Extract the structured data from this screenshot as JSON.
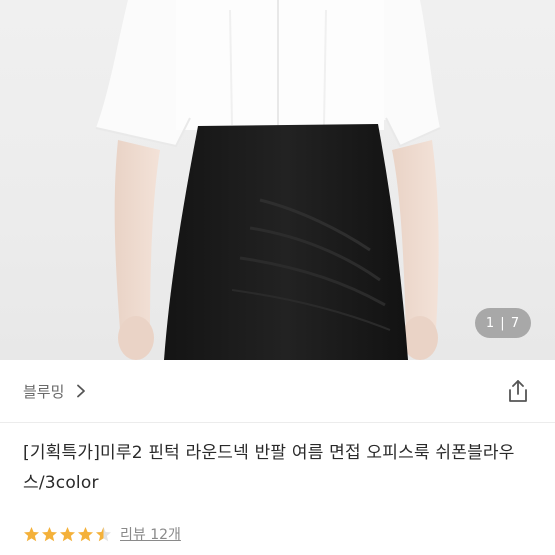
{
  "gallery": {
    "counter": "1 | 7",
    "current": 1,
    "total": 7
  },
  "store": {
    "name": "블루밍",
    "chevron_icon": "chevron-right-icon"
  },
  "share": {
    "icon": "share-icon"
  },
  "product": {
    "title": "[기획특가]미루2 핀턱 라운드넥 반팔 여름 면접 오피스룩 쉬폰블라우스/3color"
  },
  "rating": {
    "value": 4.5,
    "max": 5,
    "review_label": "리뷰 12개"
  },
  "colors": {
    "star": "#f4b13a",
    "star_empty": "#e3e3e3",
    "text_secondary": "#6a6a6a"
  }
}
